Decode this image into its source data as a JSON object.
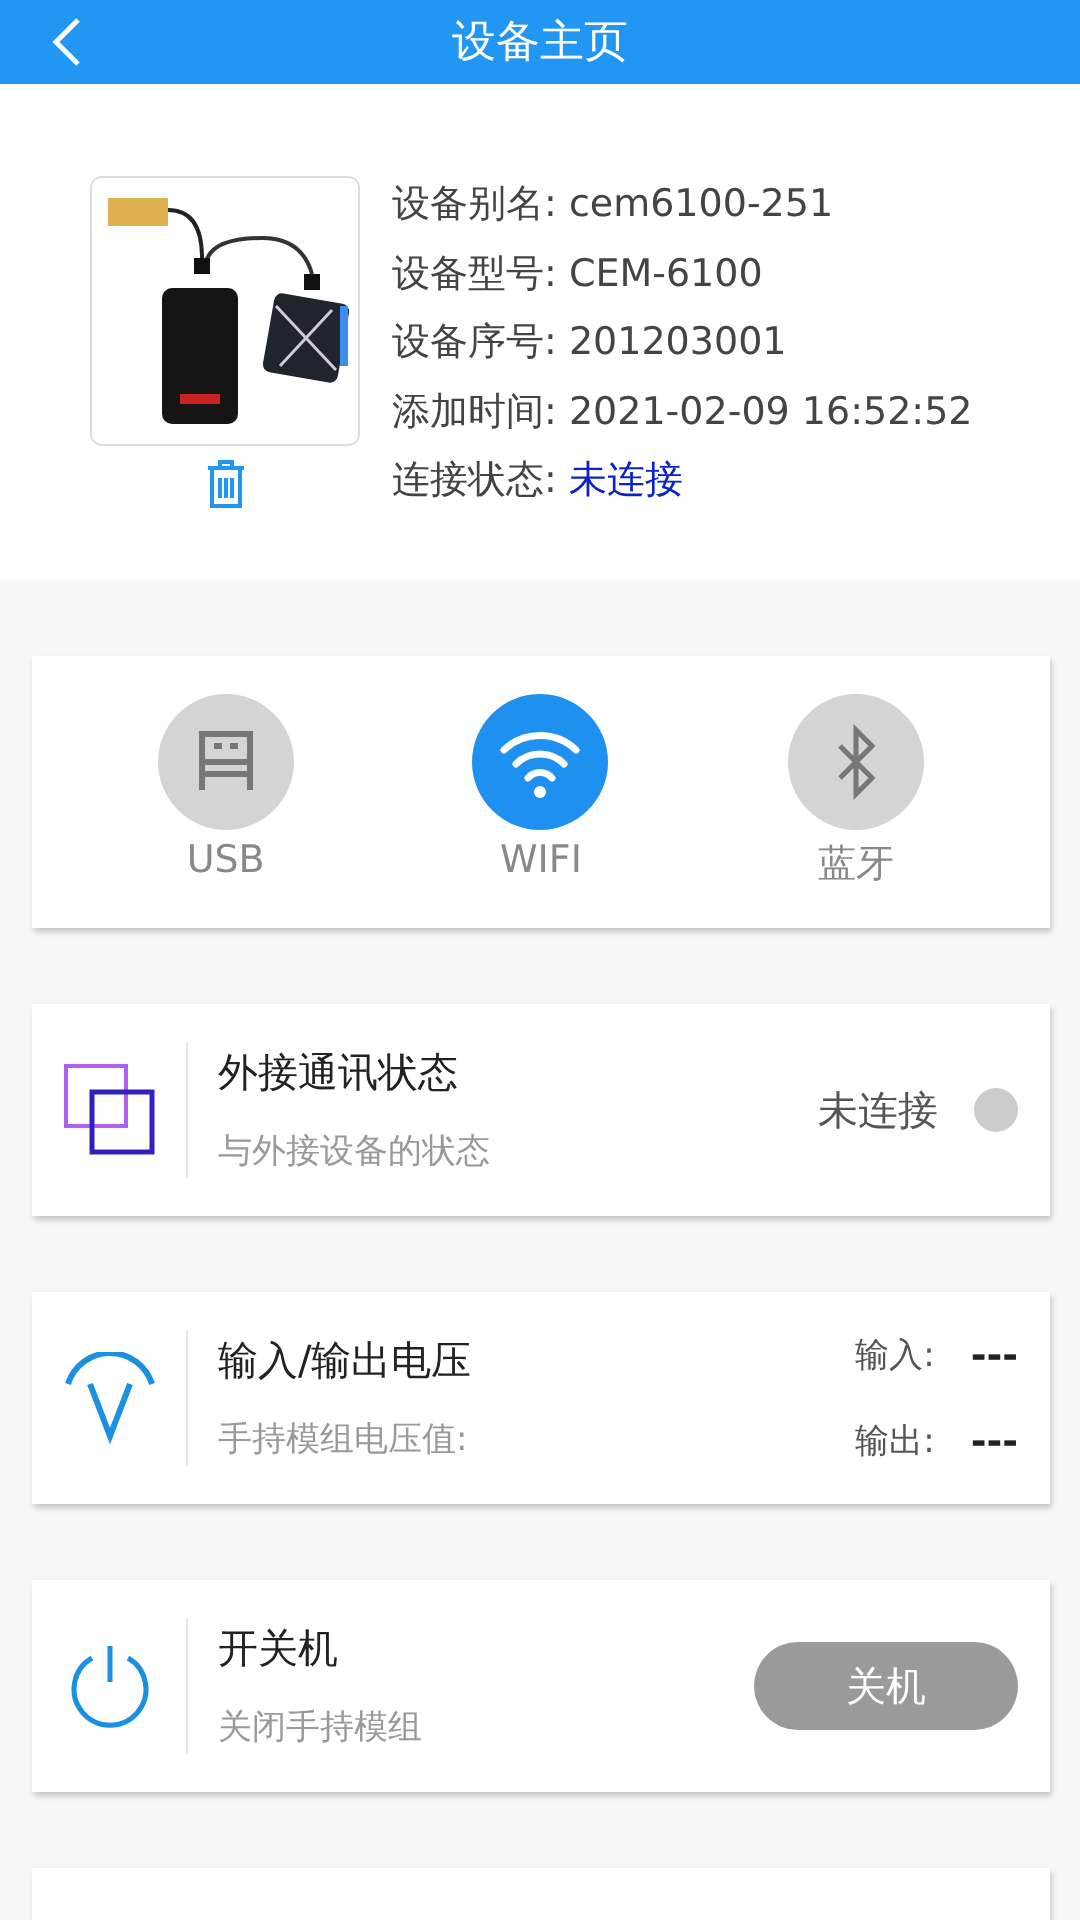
{
  "header": {
    "title": "设备主页"
  },
  "device": {
    "fields": [
      {
        "label": "设备别名:",
        "value": "cem6100-251",
        "kind": "plain"
      },
      {
        "label": "设备型号:",
        "value": "CEM-6100",
        "kind": "plain"
      },
      {
        "label": "设备序号:",
        "value": "201203001",
        "kind": "plain"
      },
      {
        "label": "添加时间:",
        "value": "2021-02-09 16:52:52",
        "kind": "plain"
      },
      {
        "label": "连接状态:",
        "value": "未连接",
        "kind": "status"
      }
    ]
  },
  "connection_modes": [
    {
      "label": "USB",
      "kind": "usb",
      "selected": false
    },
    {
      "label": "WIFI",
      "kind": "wifi",
      "selected": true
    },
    {
      "label": "蓝牙",
      "kind": "bluetooth",
      "selected": false
    }
  ],
  "cards": [
    {
      "kind": "status",
      "title": "外接通讯状态",
      "subtitle": "与外接设备的状态",
      "status": "未连接",
      "connected": false
    },
    {
      "kind": "voltage",
      "title": "输入/输出电压",
      "subtitle": "手持模组电压值:",
      "readings": [
        {
          "label": "输入:",
          "value": "---"
        },
        {
          "label": "输出:",
          "value": "---"
        }
      ]
    },
    {
      "kind": "power",
      "title": "开关机",
      "subtitle": "关闭手持模组",
      "button": "关机"
    },
    {
      "kind": "partial"
    }
  ]
}
